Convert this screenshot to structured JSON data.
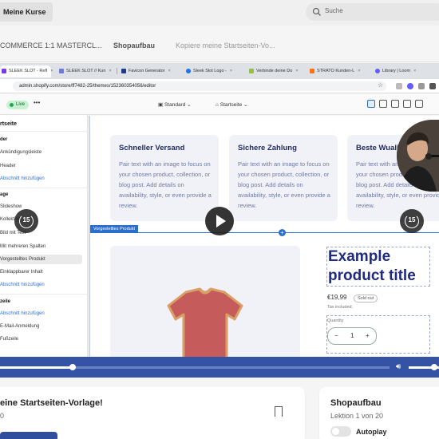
{
  "topbar": {
    "courses_button": "Meine Kurse",
    "search_placeholder": "Suche"
  },
  "breadcrumb": [
    "COMMERCE 1:1 MASTERCL...",
    "Shopaufbau",
    "Kopiere meine Startseiten-Vo..."
  ],
  "browser": {
    "tabs": [
      {
        "label": "SLEEK SLOT - Refl",
        "color": "#7c3aed",
        "active": true
      },
      {
        "label": "SLEEK SLOT // Kun",
        "color": "#6b7bd6",
        "active": false
      },
      {
        "label": "Favicon Generator",
        "color": "#1e3a8a",
        "active": false
      },
      {
        "label": "Sleek Slot Logo -",
        "color": "#1a73e8",
        "active": false
      },
      {
        "label": "Verbinde deine Do",
        "color": "#95bf47",
        "active": false
      },
      {
        "label": "STRATO Kunden-L",
        "color": "#f97316",
        "active": false
      },
      {
        "label": "Library | Loom",
        "color": "#625df5",
        "active": false
      }
    ],
    "address": "admin.shopify.com/store/ff7482-25/themes/152360354056/editor"
  },
  "editor": {
    "status": "Live",
    "template_select": "Standard",
    "page_select": "Startseite"
  },
  "sidebar": {
    "title": "rtseite",
    "header_group": "der",
    "items_header": [
      "Ankündigungsleiste",
      "Header"
    ],
    "add_section": "Abschnitt hinzufügen",
    "template_group": "age",
    "items_template": [
      "Slideshow",
      "Kollektion",
      "Bild mit Text",
      "Mit mehreren Spalten",
      "Vorgestelltes Produkt",
      "Einklappbarer Inhalt"
    ],
    "footer_group": "zeile",
    "items_footer": [
      "E-Mail-Anmeldung",
      "Fußzeile"
    ]
  },
  "features": [
    {
      "title": "Schneller Versand",
      "body": "Pair text with an image to focus on your chosen product, collection, or blog post. Add details on availability, style, or even provide a review."
    },
    {
      "title": "Sichere Zahlung",
      "body": "Pair text with an image to focus on your chosen product, collection, or blog post. Add details on availability, style, or even provide a review."
    },
    {
      "title": "Beste Wuali",
      "body": "Pair text with an image to focus on your chosen product, collection, or blog post. Add details on availability, style, or even provide a review."
    }
  ],
  "product": {
    "section_label": "Vorgestelltes Produkt",
    "title": "Example product title",
    "price": "€19,99",
    "badge": "Sold out",
    "tax": "Tax included.",
    "quantity_label": "Quantity",
    "quantity": "1",
    "minus": "−",
    "plus": "+"
  },
  "video": {
    "skip_seconds": "15",
    "progress_fraction": 0.186,
    "volume_fraction": 0.75
  },
  "lesson": {
    "title": "eine Startseiten-Vorlage!",
    "sub": "0"
  },
  "module": {
    "title": "Shopaufbau",
    "progress": "Lektion 1 von 20",
    "autoplay": "Autoplay"
  },
  "colors": {
    "accent": "#2c6ecb",
    "video_bar": "#3553a4",
    "card_title": "#1f2a5e",
    "tshirt": "#c65b5b",
    "tshirt_trim": "#d9a066"
  }
}
